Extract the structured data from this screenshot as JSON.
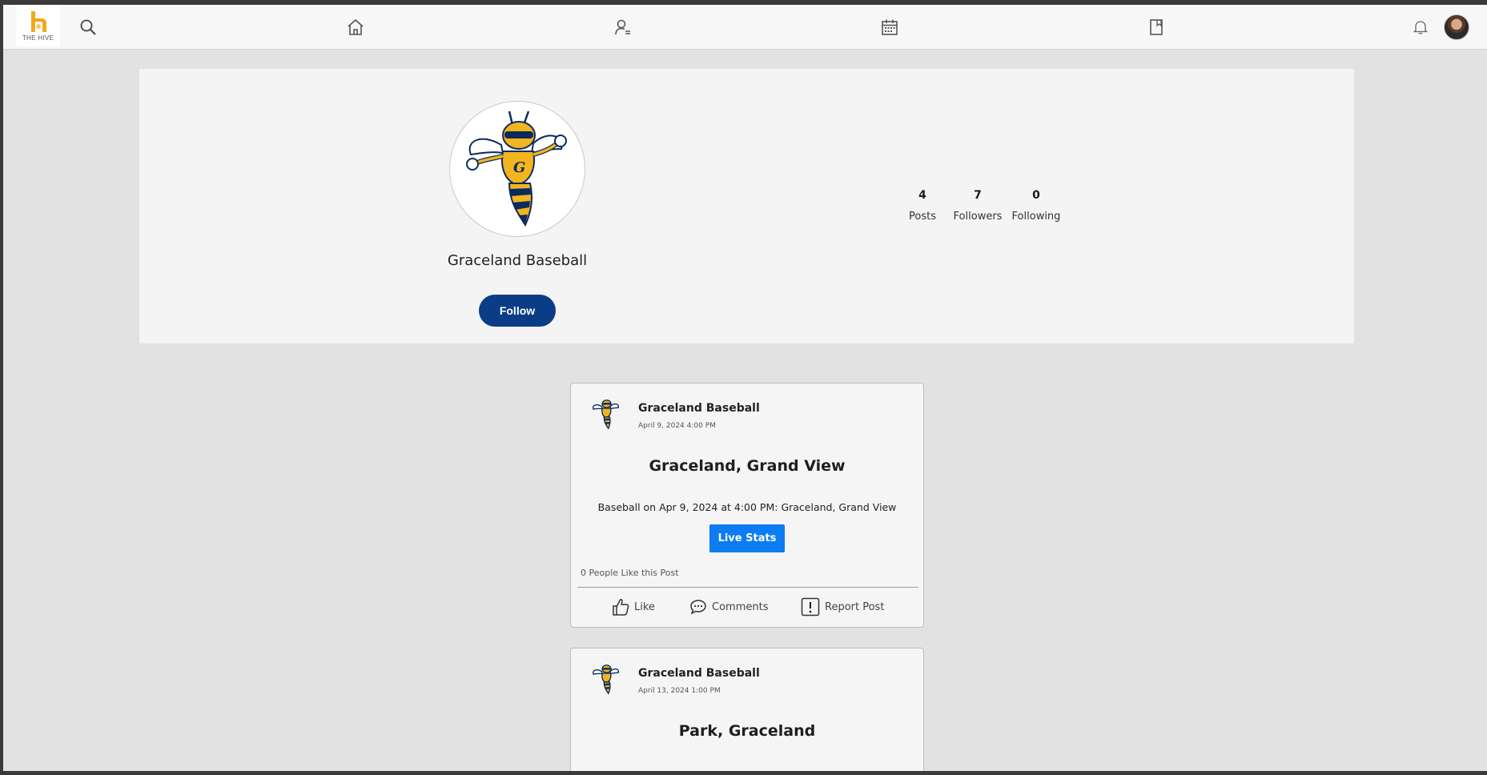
{
  "app": {
    "logo_text": "THE HIVE"
  },
  "nav": {
    "icons": [
      "search-icon",
      "home-icon",
      "people-icon",
      "calendar-icon",
      "bookmark-icon",
      "bell-icon"
    ]
  },
  "profile": {
    "name": "Graceland Baseball",
    "follow_label": "Follow",
    "stats": [
      {
        "value": "4",
        "label": "Posts"
      },
      {
        "value": "7",
        "label": "Followers"
      },
      {
        "value": "0",
        "label": "Following"
      }
    ]
  },
  "posts": [
    {
      "author": "Graceland Baseball",
      "date": "April 9, 2024 4:00 PM",
      "title": "Graceland, Grand View",
      "body": "Baseball on Apr 9, 2024 at 4:00 PM: Graceland, Grand View",
      "button_label": "Live Stats",
      "likes_text": "0 People Like this Post",
      "actions": {
        "like": "Like",
        "comments": "Comments",
        "report": "Report Post"
      }
    },
    {
      "author": "Graceland Baseball",
      "date": "April 13, 2024 1:00 PM",
      "title": "Park, Graceland"
    }
  ],
  "colors": {
    "accent_blue": "#0d7cf2",
    "follow_navy": "#0b3d86",
    "logo_gold": "#f2a81d",
    "page_bg": "#e2e2e2"
  }
}
